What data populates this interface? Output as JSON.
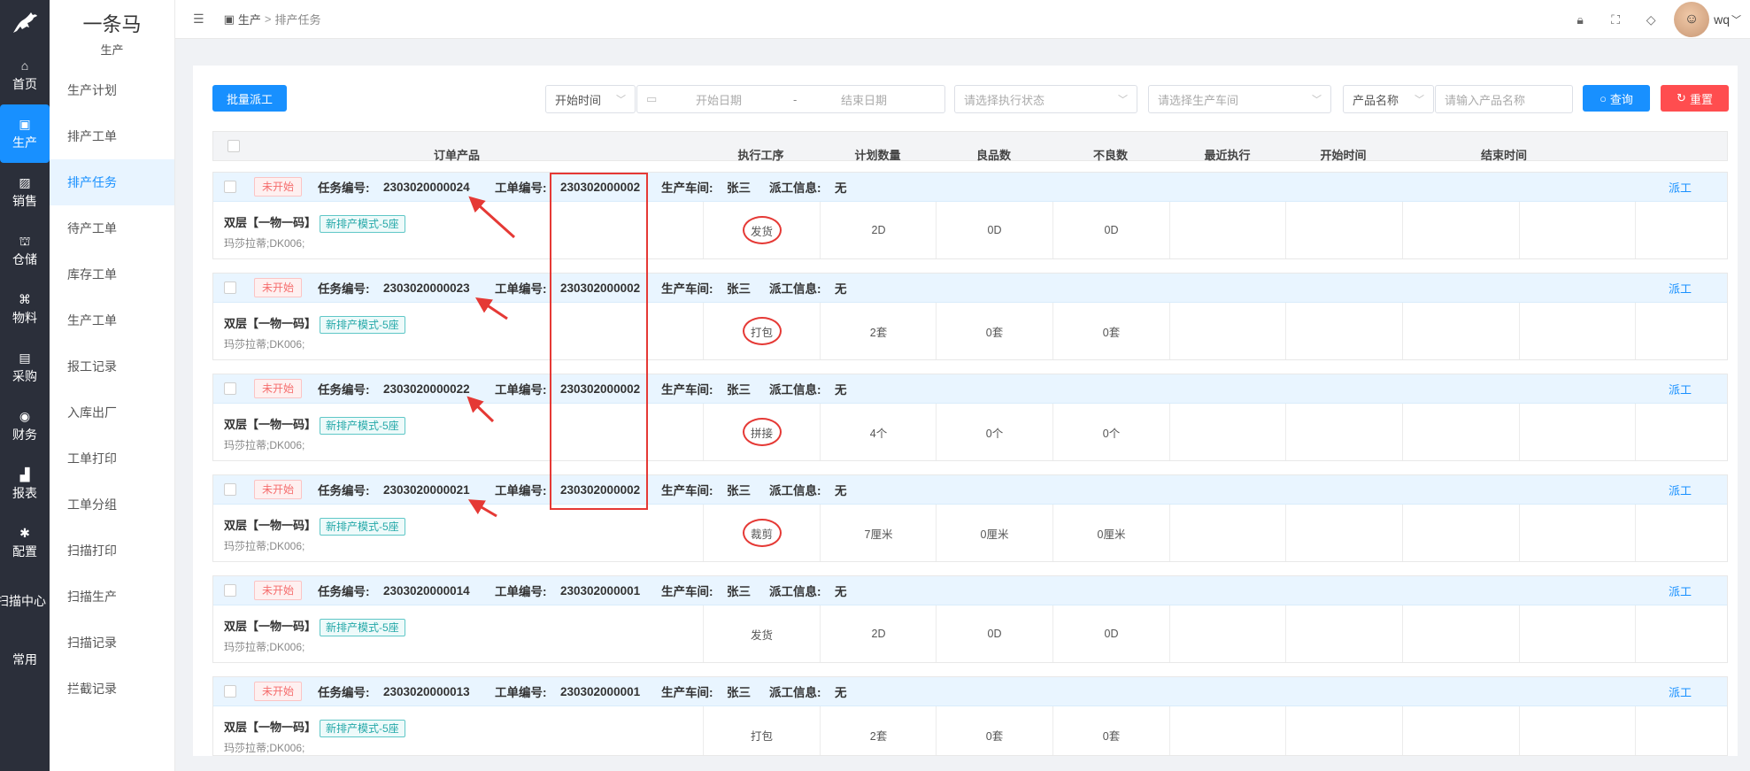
{
  "rail": [
    {
      "label": "首页",
      "icon": "home-icon",
      "glyph": "⌂"
    },
    {
      "label": "生产",
      "icon": "box-icon",
      "glyph": "▣",
      "active": true
    },
    {
      "label": "销售",
      "icon": "image-icon",
      "glyph": "▨"
    },
    {
      "label": "仓储",
      "icon": "warehouse-icon",
      "glyph": "⛫"
    },
    {
      "label": "物料",
      "icon": "command-icon",
      "glyph": "⌘"
    },
    {
      "label": "采购",
      "icon": "bag-icon",
      "glyph": "▤"
    },
    {
      "label": "财务",
      "icon": "finance-icon",
      "glyph": "◉"
    },
    {
      "label": "报表",
      "icon": "bar-chart-icon",
      "glyph": "▟"
    },
    {
      "label": "配置",
      "icon": "gear-icon",
      "glyph": "✱"
    },
    {
      "label": "扫描中心",
      "icon": "",
      "glyph": ""
    },
    {
      "label": "常用",
      "icon": "",
      "glyph": ""
    }
  ],
  "sidebar": {
    "brand": "一条马",
    "section": "生产",
    "items": [
      "生产计划",
      "排产工单",
      "排产任务",
      "待产工单",
      "库存工单",
      "生产工单",
      "报工记录",
      "入库出厂",
      "工单打印",
      "工单分组",
      "扫描打印",
      "扫描生产",
      "扫描记录",
      "拦截记录"
    ]
  },
  "header": {
    "breadcrumb_root": "生产",
    "breadcrumb_sep": ">",
    "breadcrumb_current": "排产任务",
    "username": "wq"
  },
  "toolbar": {
    "batch_dispatch": "批量派工",
    "time_type": "开始时间",
    "start_date_placeholder": "开始日期",
    "date_sep": "-",
    "end_date_placeholder": "结束日期",
    "status_placeholder": "请选择执行状态",
    "workshop_placeholder": "请选择生产车间",
    "product_field": "产品名称",
    "product_placeholder": "请输入产品名称",
    "query": "查询",
    "reset": "重置"
  },
  "columns": [
    "订单产品",
    "执行工序",
    "计划数量",
    "良品数",
    "不良数",
    "最近执行",
    "开始时间",
    "结束时间"
  ],
  "labels": {
    "task_no": "任务编号:",
    "order_no": "工单编号:",
    "workshop": "生产车间:",
    "dispatch_info": "派工信息:",
    "dispatch_link": "派工"
  },
  "rows": [
    {
      "status": "未开始",
      "task_no": "2303020000024",
      "order_no": "230302000002",
      "workshop": "张三",
      "dispatch_info": "无",
      "product": "双层【一物一码】",
      "mode": "新排产模式-5座",
      "spec": "玛莎拉蒂;DK006;",
      "process": "发货",
      "plan": "2D",
      "good": "0D",
      "bad": "0D",
      "circled": true
    },
    {
      "status": "未开始",
      "task_no": "2303020000023",
      "order_no": "230302000002",
      "workshop": "张三",
      "dispatch_info": "无",
      "product": "双层【一物一码】",
      "mode": "新排产模式-5座",
      "spec": "玛莎拉蒂;DK006;",
      "process": "打包",
      "plan": "2套",
      "good": "0套",
      "bad": "0套",
      "circled": true
    },
    {
      "status": "未开始",
      "task_no": "2303020000022",
      "order_no": "230302000002",
      "workshop": "张三",
      "dispatch_info": "无",
      "product": "双层【一物一码】",
      "mode": "新排产模式-5座",
      "spec": "玛莎拉蒂;DK006;",
      "process": "拼接",
      "plan": "4个",
      "good": "0个",
      "bad": "0个",
      "circled": true
    },
    {
      "status": "未开始",
      "task_no": "2303020000021",
      "order_no": "230302000002",
      "workshop": "张三",
      "dispatch_info": "无",
      "product": "双层【一物一码】",
      "mode": "新排产模式-5座",
      "spec": "玛莎拉蒂;DK006;",
      "process": "裁剪",
      "plan": "7厘米",
      "good": "0厘米",
      "bad": "0厘米",
      "circled": true
    },
    {
      "status": "未开始",
      "task_no": "2303020000014",
      "order_no": "230302000001",
      "workshop": "张三",
      "dispatch_info": "无",
      "product": "双层【一物一码】",
      "mode": "新排产模式-5座",
      "spec": "玛莎拉蒂;DK006;",
      "process": "发货",
      "plan": "2D",
      "good": "0D",
      "bad": "0D",
      "circled": false
    },
    {
      "status": "未开始",
      "task_no": "2303020000013",
      "order_no": "230302000001",
      "workshop": "张三",
      "dispatch_info": "无",
      "product": "双层【一物一码】",
      "mode": "新排产模式-5座",
      "spec": "玛莎拉蒂;DK006;",
      "process": "打包",
      "plan": "2套",
      "good": "0套",
      "bad": "0套",
      "circled": false
    }
  ],
  "colors": {
    "primary": "#1890ff",
    "danger": "#ff4d4f",
    "annotation": "#e53935",
    "rail": "#2b2f3a"
  }
}
